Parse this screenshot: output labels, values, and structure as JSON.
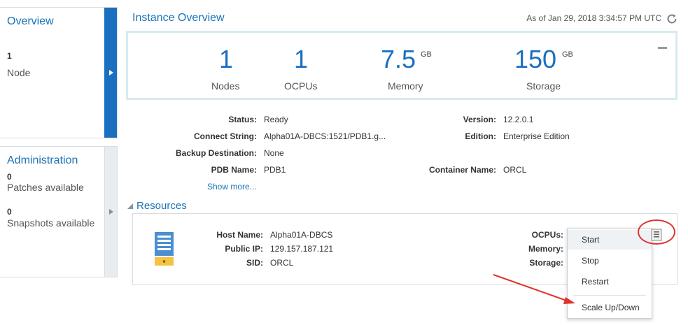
{
  "overview_card": {
    "title": "Overview",
    "count": "1",
    "label": "Node"
  },
  "admin_card": {
    "title": "Administration",
    "patches_count": "0",
    "patches_label": "Patches available",
    "snapshots_count": "0",
    "snapshots_label": "Snapshots available"
  },
  "header": {
    "title": "Instance Overview",
    "as_of": "As of Jan 29, 2018 3:34:57 PM UTC"
  },
  "summary": {
    "nodes": {
      "value": "1",
      "label": "Nodes"
    },
    "ocpus": {
      "value": "1",
      "label": "OCPUs"
    },
    "memory": {
      "value": "7.5",
      "unit": "GB",
      "label": "Memory"
    },
    "storage": {
      "value": "150",
      "unit": "GB",
      "label": "Storage"
    }
  },
  "details": {
    "status": {
      "label": "Status:",
      "value": "Ready"
    },
    "connect_string": {
      "label": "Connect String:",
      "value": "Alpha01A-DBCS:1521/PDB1.g..."
    },
    "backup_destination": {
      "label": "Backup Destination:",
      "value": "None"
    },
    "pdb_name": {
      "label": "PDB Name:",
      "value": "PDB1"
    },
    "version": {
      "label": "Version:",
      "value": "12.2.0.1"
    },
    "edition": {
      "label": "Edition:",
      "value": "Enterprise Edition"
    },
    "container_name": {
      "label": "Container Name:",
      "value": "ORCL"
    },
    "show_more": "Show more..."
  },
  "resources": {
    "title": "Resources",
    "host_name": {
      "label": "Host Name:",
      "value": "Alpha01A-DBCS"
    },
    "public_ip": {
      "label": "Public IP:",
      "value": "129.157.187.121"
    },
    "sid": {
      "label": "SID:",
      "value": "ORCL"
    },
    "ocpus_label": "OCPUs:",
    "memory_label": "Memory:",
    "storage_label": "Storage:"
  },
  "menu": {
    "items": [
      "Start",
      "Stop",
      "Restart",
      "Scale Up/Down"
    ]
  },
  "colors": {
    "accent": "#1a73b8",
    "overview_rail": "#1a6fc0",
    "annotation": "#e0332c"
  },
  "icons": {
    "refresh": "refresh-icon",
    "server": "server-icon",
    "actions_menu": "menu-icon",
    "collapse": "collapse-icon"
  }
}
